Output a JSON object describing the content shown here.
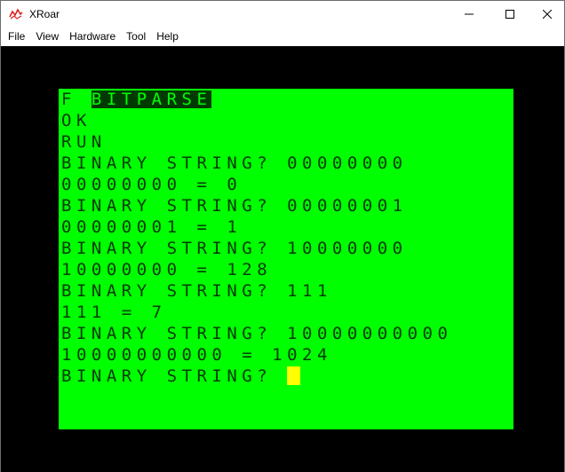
{
  "window": {
    "title": "XRoar"
  },
  "menu": {
    "items": [
      "File",
      "View",
      "Hardware",
      "Tool",
      "Help"
    ]
  },
  "screen": {
    "bg_color": "#00ff00",
    "fg_color": "#003a00",
    "cursor_color": "#ffff00",
    "first_line": {
      "prefix": "F ",
      "highlighted": "BITPARSE"
    },
    "lines": [
      "OK",
      "RUN",
      "BINARY STRING? 00000000",
      "00000000 = 0",
      "BINARY STRING? 00000001",
      "00000001 = 1",
      "BINARY STRING? 10000000",
      "10000000 = 128",
      "BINARY STRING? 111",
      "111 = 7",
      "BINARY STRING? 10000000000",
      "10000000000 = 1024"
    ],
    "prompt": "BINARY STRING? "
  }
}
